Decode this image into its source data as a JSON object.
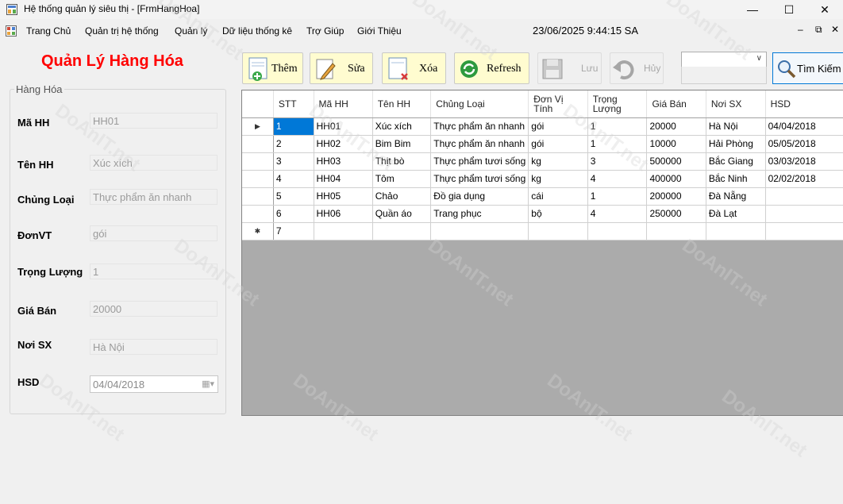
{
  "window": {
    "title": "Hệ thống quản lý siêu thị - [FrmHangHoa]"
  },
  "menu": {
    "items": [
      "Trang Chủ",
      "Quản trị hệ thống",
      "Quản lý",
      "Dữ liệu thống kê",
      "Trợ Giúp",
      "Giới Thiệu"
    ],
    "clock": "23/06/2025 9:44:15 SA"
  },
  "page": {
    "title": "Quản Lý Hàng Hóa"
  },
  "form": {
    "group_title": "Hàng Hóa",
    "fields": [
      {
        "label": "Mã HH",
        "value": "HH01"
      },
      {
        "label": "Tên HH",
        "value": "Xúc xích"
      },
      {
        "label": "Chủng Loại",
        "value": "Thực phẩm ăn nhanh"
      },
      {
        "label": "ĐơnVT",
        "value": "gói"
      },
      {
        "label": "Trọng Lượng",
        "value": "1"
      },
      {
        "label": "Giá Bán",
        "value": "20000"
      },
      {
        "label": "Nơi SX",
        "value": "Hà Nội"
      }
    ],
    "hsd": {
      "label": "HSD",
      "value": "04/04/2018"
    }
  },
  "toolbar": {
    "add": "Thêm",
    "edit": "Sửa",
    "delete": "Xóa",
    "refresh": "Refresh",
    "save": "Lưu",
    "cancel": "Hủy",
    "search": "Tìm Kiếm"
  },
  "grid": {
    "columns": [
      "STT",
      "Mã HH",
      "Tên HH",
      "Chủng Loại",
      "Đơn Vị Tính",
      "Trọng Lượng",
      "Giá Bán",
      "Nơi SX",
      "HSD"
    ],
    "rows": [
      [
        "1",
        "HH01",
        "Xúc xích",
        "Thực phẩm ăn nhanh",
        "gói",
        "1",
        "20000",
        "Hà Nội",
        "04/04/2018"
      ],
      [
        "2",
        "HH02",
        "Bim Bim",
        "Thực phẩm ăn nhanh",
        "gói",
        "1",
        "10000",
        "Hải Phòng",
        "05/05/2018"
      ],
      [
        "3",
        "HH03",
        "Thịt bò",
        "Thực phẩm tươi sống",
        "kg",
        "3",
        "500000",
        "Bắc Giang",
        "03/03/2018"
      ],
      [
        "4",
        "HH04",
        "Tôm",
        "Thực phẩm tươi sống",
        "kg",
        "4",
        "400000",
        "Bắc Ninh",
        "02/02/2018"
      ],
      [
        "5",
        "HH05",
        "Chảo",
        "Đồ gia dụng",
        "cái",
        "1",
        "200000",
        "Đà Nẵng",
        ""
      ],
      [
        "6",
        "HH06",
        "Quần áo",
        "Trang phục",
        "bộ",
        "4",
        "250000",
        "Đà Lạt",
        ""
      ]
    ],
    "new_row": "7"
  },
  "watermark": "DoAnIT.net"
}
